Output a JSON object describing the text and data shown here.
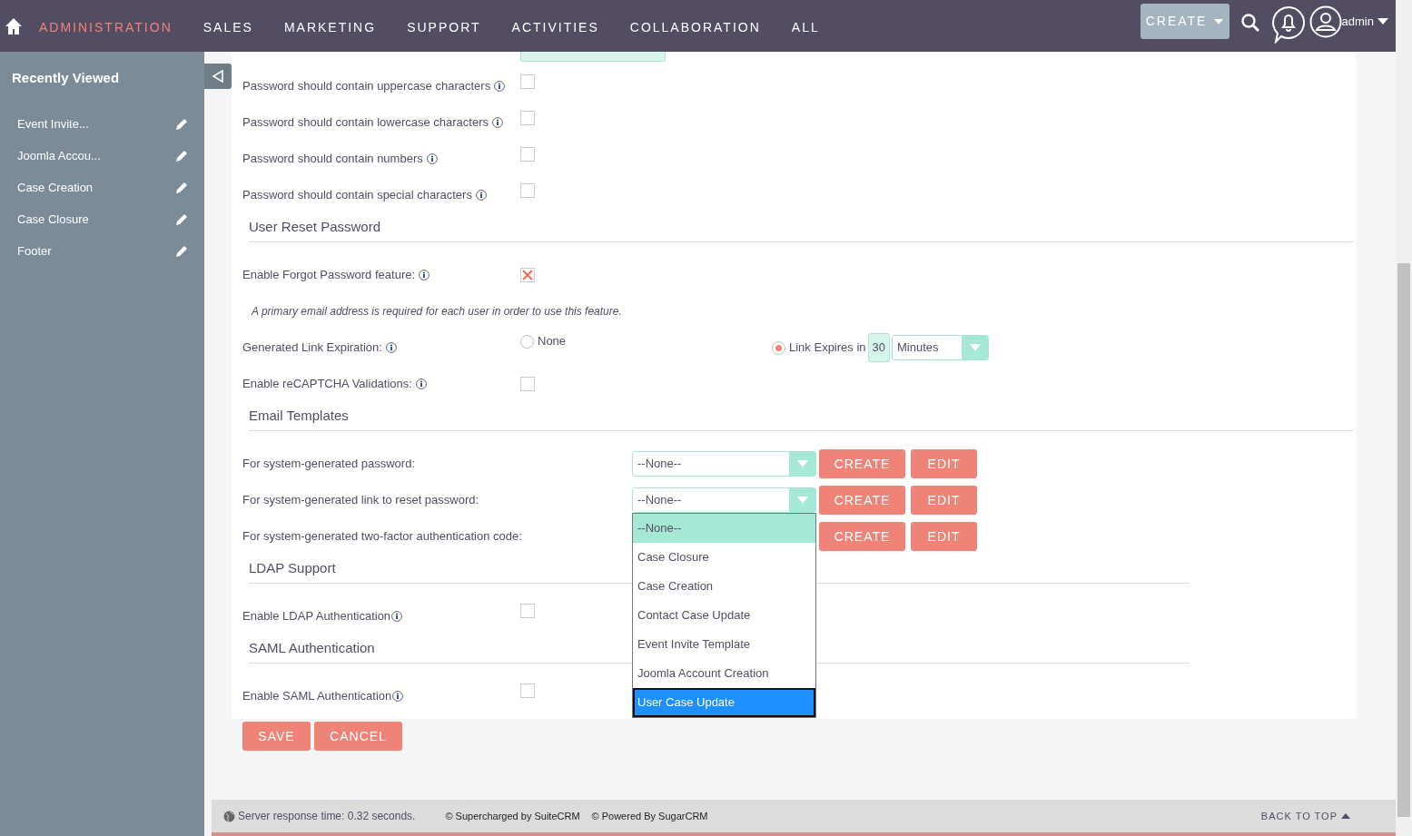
{
  "navbar": {
    "tabs": [
      {
        "label": "ADMINISTRATION",
        "selected": true
      },
      {
        "label": "SALES",
        "selected": false
      },
      {
        "label": "MARKETING",
        "selected": false
      },
      {
        "label": "SUPPORT",
        "selected": false
      },
      {
        "label": "ACTIVITIES",
        "selected": false
      },
      {
        "label": "COLLABORATION",
        "selected": false
      },
      {
        "label": "ALL",
        "selected": false
      }
    ],
    "create_button": "CREATE",
    "user": "admin"
  },
  "sidebar": {
    "title": "Recently Viewed",
    "items": [
      {
        "label": "Event Invite..."
      },
      {
        "label": "Joomla Accou..."
      },
      {
        "label": "Case Creation"
      },
      {
        "label": "Case Closure"
      },
      {
        "label": "Footer"
      }
    ]
  },
  "password_rules": [
    {
      "label": "Password should contain uppercase characters",
      "checked": false
    },
    {
      "label": "Password should contain lowercase characters",
      "checked": false
    },
    {
      "label": "Password should contain numbers",
      "checked": false
    },
    {
      "label": "Password should contain special characters",
      "checked": false
    }
  ],
  "reset_section": {
    "heading": "User Reset Password",
    "forgot": {
      "label": "Enable Forgot Password feature:",
      "checked": true
    },
    "note": "A primary email address is required for each user in order to use this feature.",
    "expiration": {
      "label": "Generated Link Expiration:",
      "options": [
        {
          "label": "None",
          "selected": false
        },
        {
          "label": "Link Expires in",
          "selected": true
        }
      ],
      "amount": "30",
      "unit": "Minutes"
    },
    "recaptcha": {
      "label": "Enable reCAPTCHA Validations:",
      "checked": false
    }
  },
  "email_templates": {
    "heading": "Email Templates",
    "rows": [
      {
        "label": "For system-generated password:",
        "value": "--None--",
        "create": "CREATE",
        "edit": "EDIT"
      },
      {
        "label": "For system-generated link to reset password:",
        "value": "--None--",
        "options": [
          {
            "label": "--None--",
            "selected": true,
            "highlighted": false
          },
          {
            "label": "Case Closure",
            "selected": false,
            "highlighted": false
          },
          {
            "label": "Case Creation",
            "selected": false,
            "highlighted": false
          },
          {
            "label": "Contact Case Update",
            "selected": false,
            "highlighted": false
          },
          {
            "label": "Event Invite Template",
            "selected": false,
            "highlighted": false
          },
          {
            "label": "Joomla Account Creation",
            "selected": false,
            "highlighted": false
          },
          {
            "label": "User Case Update",
            "selected": false,
            "highlighted": true
          }
        ],
        "create": "CREATE",
        "edit": "EDIT"
      },
      {
        "label": "For system-generated two-factor authentication code:",
        "create": "CREATE",
        "edit": "EDIT"
      }
    ]
  },
  "ldap": {
    "heading": "LDAP Support",
    "label": "Enable LDAP Authentication",
    "checked": false
  },
  "saml": {
    "heading": "SAML Authentication",
    "label": "Enable SAML Authentication",
    "checked": false
  },
  "actions": {
    "save": "SAVE",
    "cancel": "CANCEL"
  },
  "footer": {
    "response_time": "Server response time: 0.32 seconds.",
    "supercharged": "© Supercharged by SuiteCRM",
    "powered": "© Powered By SugarCRM",
    "back_to_top": "BACK TO TOP"
  }
}
